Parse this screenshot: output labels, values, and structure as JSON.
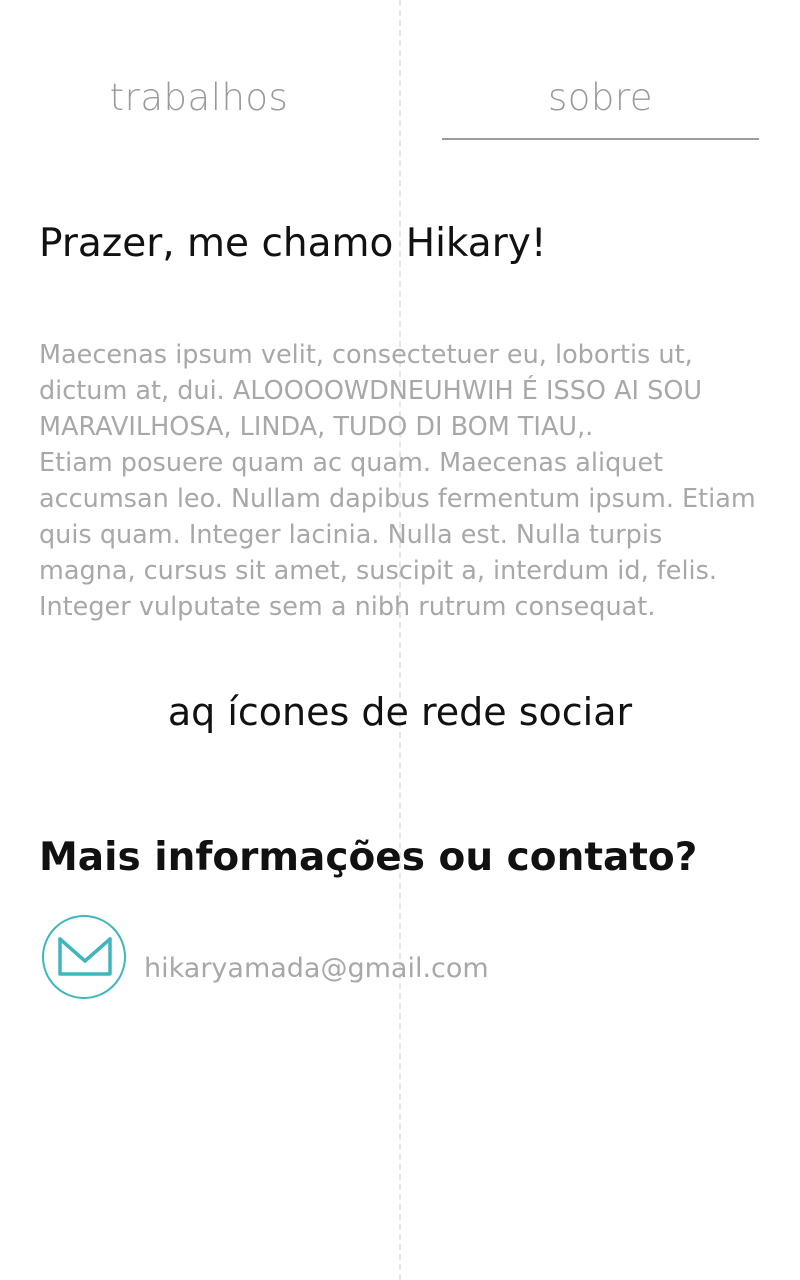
{
  "nav": {
    "tabs": [
      {
        "label": "trabalhos",
        "active": false
      },
      {
        "label": "sobre",
        "active": true
      }
    ]
  },
  "about": {
    "greeting": "Prazer, me chamo Hikary!",
    "bio_paragraph_1": "Maecenas ipsum velit, consectetuer eu, lobortis ut, dictum at, dui. ALOOOOWDNEUHWIH É ISSO AI SOU MARAVILHOSA, LINDA, TUDO DI BOM TIAU,.",
    "bio_paragraph_2": "Etiam posuere quam ac quam. Maecenas aliquet accumsan leo. Nullam dapibus fermentum ipsum. Etiam quis quam. Integer lacinia. Nulla est. Nulla turpis magna, cursus sit amet, suscipit a, interdum id, felis. Integer vulputate sem a nibh rutrum consequat."
  },
  "social": {
    "placeholder_text": "aq ícones de rede sociar"
  },
  "contact": {
    "heading": "Mais informações ou contato?",
    "email": "hikaryamada@gmail.com",
    "icon": "mail-icon"
  },
  "colors": {
    "accent": "#3fb6bd",
    "text_dark": "#111111",
    "text_muted": "#a8a8a8",
    "tab_text": "#9a9a9a",
    "background": "#ffffff"
  }
}
